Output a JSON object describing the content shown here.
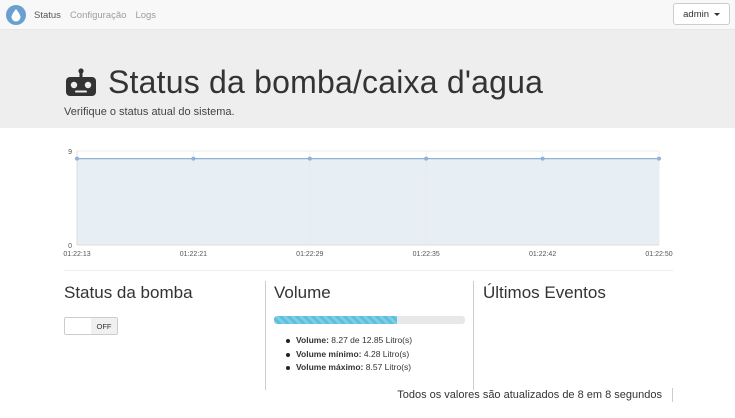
{
  "nav": {
    "links": [
      {
        "label": "Status",
        "active": true
      },
      {
        "label": "Configuração",
        "active": false
      },
      {
        "label": "Logs",
        "active": false
      }
    ],
    "user_label": "admin"
  },
  "header": {
    "title": "Status da bomba/caixa d'agua",
    "subtitle": "Verifique o status atual do sistema."
  },
  "chart_data": {
    "type": "area",
    "x": [
      "01:22:13",
      "01:22:21",
      "01:22:29",
      "01:22:35",
      "01:22:42",
      "01:22:50"
    ],
    "values": [
      8.27,
      8.27,
      8.27,
      8.27,
      8.27,
      8.27
    ],
    "ylim": [
      0,
      9
    ],
    "yticks": [
      "0",
      "9"
    ],
    "grid": true,
    "colors": {
      "line": "#8fb2d6",
      "fill": "#e3ebf2"
    }
  },
  "pump": {
    "title": "Status da bomba",
    "toggle_label": "OFF",
    "state": false
  },
  "volume": {
    "title": "Volume",
    "progress": 0.644,
    "items": [
      {
        "label": "Volume:",
        "value": "8.27 de 12.85 Litro(s)"
      },
      {
        "label": "Volume mínimo:",
        "value": "4.28 Litro(s)"
      },
      {
        "label": "Volume máximo:",
        "value": "8.57 Litro(s)"
      }
    ]
  },
  "events": {
    "title": "Últimos Eventos"
  },
  "footer": {
    "note": "Todos os valores são atualizados de 8 em 8 segundos"
  }
}
